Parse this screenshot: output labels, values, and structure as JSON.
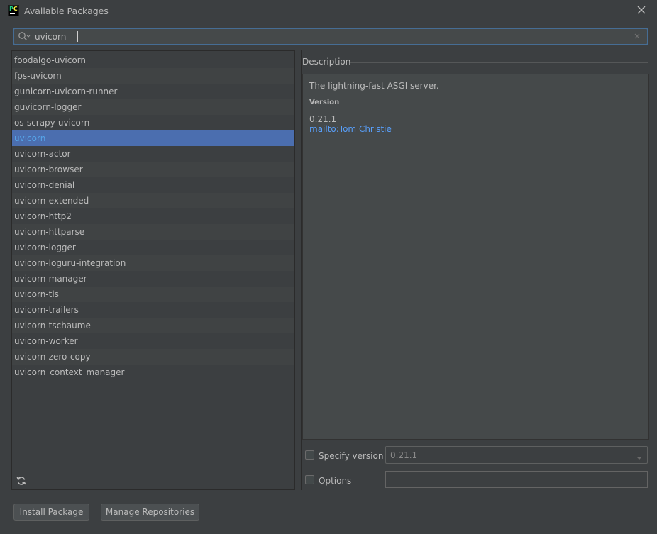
{
  "window": {
    "title": "Available Packages",
    "logo_text": "PC"
  },
  "search": {
    "value": "uvicorn"
  },
  "packages": [
    "foodalgo-uvicorn",
    "fps-uvicorn",
    "gunicorn-uvicorn-runner",
    "guvicorn-logger",
    "os-scrapy-uvicorn",
    "uvicorn",
    "uvicorn-actor",
    "uvicorn-browser",
    "uvicorn-denial",
    "uvicorn-extended",
    "uvicorn-http2",
    "uvicorn-httparse",
    "uvicorn-logger",
    "uvicorn-loguru-integration",
    "uvicorn-manager",
    "uvicorn-tls",
    "uvicorn-trailers",
    "uvicorn-tschaume",
    "uvicorn-worker",
    "uvicorn-zero-copy",
    "uvicorn_context_manager"
  ],
  "selected_package": "uvicorn",
  "description": {
    "header": "Description",
    "summary": "The lightning-fast ASGI server.",
    "version_label": "Version",
    "version_value": "0.21.1",
    "author_link": "mailto:Tom Christie"
  },
  "specify_version": {
    "label": "Specify version",
    "checked": false,
    "selected": "0.21.1"
  },
  "options": {
    "label": "Options",
    "checked": false,
    "value": ""
  },
  "buttons": {
    "install": "Install Package",
    "manage": "Manage Repositories"
  },
  "colors": {
    "background": "#3c3f41",
    "selection": "#4b6eaf",
    "link": "#589df6",
    "focus_border": "#466d94"
  },
  "icons": [
    "pycharm-logo-icon",
    "close-icon",
    "search-icon",
    "clear-icon",
    "refresh-icon",
    "dropdown-arrow-icon"
  ]
}
